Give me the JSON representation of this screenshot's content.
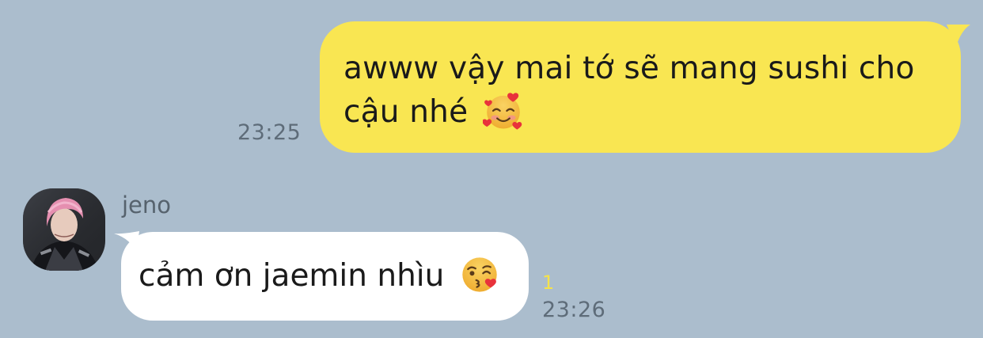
{
  "chat": {
    "messages": [
      {
        "direction": "outgoing",
        "line1": "awww vậy mai tớ sẽ mang sushi cho",
        "line2": "cậu nhé",
        "emoji": "smiling-face-with-hearts-icon",
        "time": "23:25",
        "bubble_color": "#f9e652"
      },
      {
        "direction": "incoming",
        "sender": "jeno",
        "text": "cảm ơn jaemin nhìu",
        "emoji": "face-blowing-a-kiss-icon",
        "read_count": "1",
        "time": "23:26",
        "bubble_color": "#ffffff"
      }
    ]
  },
  "theme": {
    "background": "#abbdcd",
    "unread_color": "#f5e24a"
  }
}
